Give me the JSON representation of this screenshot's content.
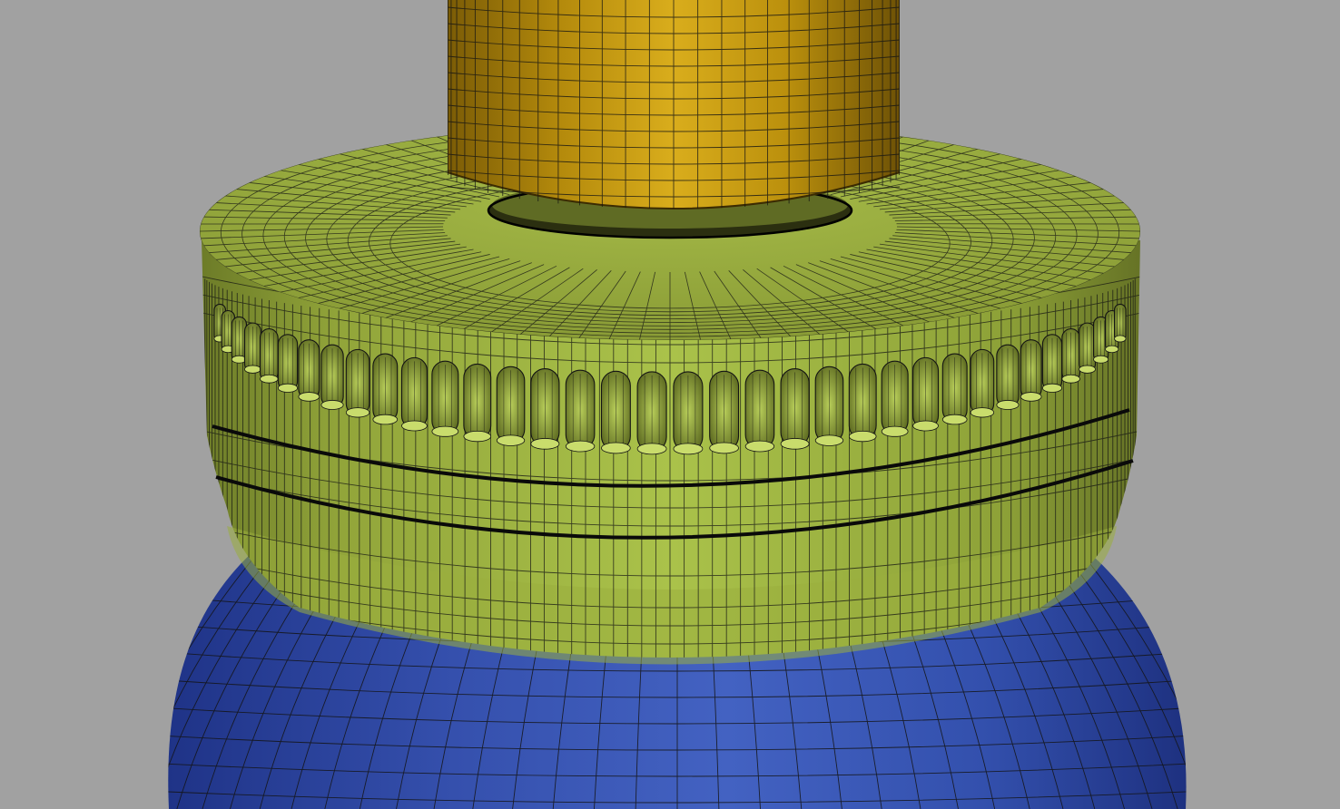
{
  "viewport": {
    "background": "#a1a1a1",
    "display_mode": "wireframe-on-shaded"
  },
  "objects": [
    {
      "name": "upper-cylinder",
      "color": "#c49a12",
      "shape": "cylinder"
    },
    {
      "name": "knurled-cap",
      "color": "#9aae3e",
      "shape": "cap-with-flutes",
      "flute_count": 36
    },
    {
      "name": "lower-bulb",
      "color": "#3a57b4",
      "shape": "sphere"
    }
  ],
  "wire_color": "#141414"
}
